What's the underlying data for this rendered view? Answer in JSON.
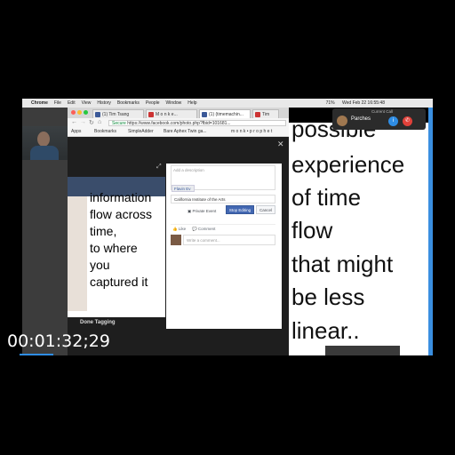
{
  "menubar": {
    "app": "Chrome",
    "items": [
      "File",
      "Edit",
      "View",
      "History",
      "Bookmarks",
      "People",
      "Window",
      "Help"
    ],
    "datetime": "Wed Feb 22  16:55:48",
    "battery": "71%"
  },
  "browser": {
    "tabs": [
      "(1) Tim Tsang",
      "M o n k e...",
      "(1) (timemachin...",
      "Tim"
    ],
    "secure_label": "Secure",
    "url": "https://www.facebook.com/photo.php?fbid=101681...",
    "bookmarks": [
      "Apps",
      "Bookmarks",
      "SimpleAdder",
      "Bare Aphex Twin ga...",
      "m o n k • p r o p h e t"
    ]
  },
  "photo": {
    "lines": [
      "information",
      "flow across",
      "time,",
      "to where",
      "you",
      "captured it"
    ],
    "tag_label": "Done Tagging"
  },
  "fb_panel": {
    "description_placeholder": "Add a description",
    "tag_chip": "Flavin Ev ×",
    "location": "California Institute of the Arts",
    "private_label": "Private Event",
    "edit_button": "Stop Editing",
    "cancel_button": "Cancel",
    "like_label": "Like",
    "comment_label": "Comment",
    "comment_placeholder": "Write a comment..."
  },
  "slide": {
    "lines": [
      "possible",
      "experience",
      "of time",
      "flow",
      "that might",
      "be less",
      "linear.."
    ]
  },
  "facetime": {
    "title": "Current Call",
    "name": "Parches"
  },
  "timecode": "00:01:32;29",
  "colors": {
    "accent": "#2f8de4",
    "fb_blue": "#4267b2",
    "decline": "#e0413a"
  }
}
